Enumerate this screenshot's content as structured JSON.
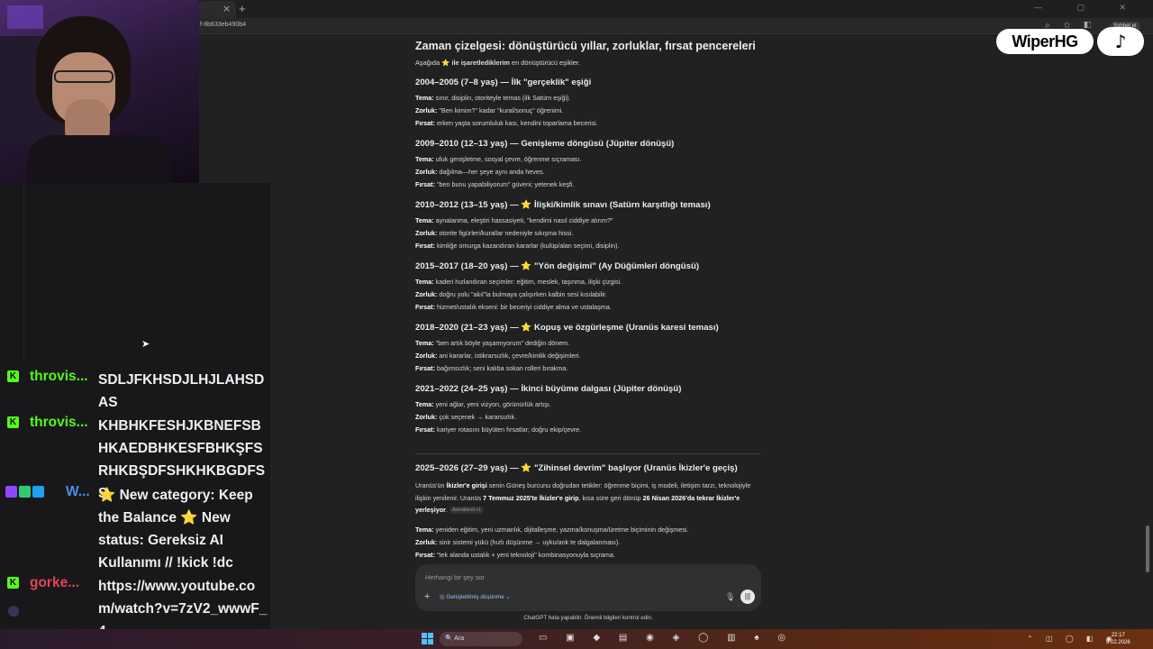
{
  "browser": {
    "tab_close": "×",
    "new_tab": "+",
    "url": "f-8b633eb490b4",
    "profile_label": "Sohbet et"
  },
  "doc": {
    "title": "Zaman çizelgesi: dönüştürücü yıllar, zorluklar, fırsat pencereleri",
    "intro_pre": "Aşağıda ",
    "intro_bold": "ile işaretlediklerim",
    "intro_post": " en dönüştürücü eşikler.",
    "sections": [
      {
        "title_pre": "2004–2005 (7–8 yaş) — İlk \"gerçeklik\" eşiği",
        "starred": false,
        "title_post": "",
        "tema": "sınır, disiplin, otoriteyle temas (ilk Satürn eşiği).",
        "zorluk": "\"Ben kimim?\" kadar \"kural/sonuç\" öğrenimi.",
        "firsat": "erken yaşta sorumluluk kası, kendini toparlama becerisi."
      },
      {
        "title_pre": "2009–2010 (12–13 yaş) — Genişleme döngüsü (Jüpiter dönüşü)",
        "starred": false,
        "title_post": "",
        "tema": "ufuk genişletme, sosyal çevre, öğrenme sıçraması.",
        "zorluk": "dağılma—her şeye aynı anda heves.",
        "firsat": "\"ben bunu yapabiliyorum\" güveni; yetenek keşfi."
      },
      {
        "title_pre": "2010–2012 (13–15 yaş) —",
        "starred": true,
        "title_post": "İlişki/kimlik sınavı (Satürn karşıtlığı teması)",
        "tema": "aynalanma, eleştiri hassasiyeti, \"kendimi nasıl ciddiye alırım?\"",
        "zorluk": "otorite figürleri/kurallar nedeniyle sıkışma hissi.",
        "firsat": "kimliğe omurga kazandıran kararlar (kulüp/alan seçimi, disiplin)."
      },
      {
        "title_pre": "2015–2017 (18–20 yaş) —",
        "starred": true,
        "title_post": "\"Yön değişimi\" (Ay Düğümleri döngüsü)",
        "tema": "kaderi hızlandıran seçimler: eğitim, meslek, taşınma, ilişki çizgisi.",
        "zorluk": "doğru yolu \"akıl\"la bulmaya çalışırken kalbin sesi kısılabilir.",
        "firsat": "hizmet/ustalık ekseni: bir beceriyi ciddiye alma ve ustalaşma."
      },
      {
        "title_pre": "2018–2020 (21–23 yaş) —",
        "starred": true,
        "title_post": "Kopuş ve özgürleşme (Uranüs karesi teması)",
        "tema": "\"ben artık böyle yaşamıyorum\" dediğin dönem.",
        "zorluk": "ani kararlar, istikrarsızlık, çevre/kimlik değişimleri.",
        "firsat": "bağımsızlık; seni kalıba sokan rolleri bırakma."
      },
      {
        "title_pre": "2021–2022 (24–25 yaş) — İkinci büyüme dalgası (Jüpiter dönüşü)",
        "starred": false,
        "title_post": "",
        "tema": "yeni ağlar, yeni vizyon, görünürlük artışı.",
        "zorluk": "çok seçenek → kararsızlık.",
        "firsat": "kariyer rotasını büyüten fırsatlar; doğru ekip/çevre."
      }
    ],
    "labels": {
      "tema": "Tema:",
      "zorluk": "Zorluk:",
      "firsat": "Fırsat:"
    },
    "star": "⭐",
    "last_section": {
      "title_pre": "2025–2026 (27–29 yaş) —",
      "title_post": "\"Zihinsel devrim\" başlıyor (Uranüs İkizler'e geçiş)",
      "para_a": "Uranüs'ün ",
      "para_b": "İkizler'e girişi",
      "para_c": " senin Güneş burcunu doğrudan tetikler: öğrenme biçimi, iş modeli, iletişim tarzı, teknolojiyle ilişkin yenilenir. Uranüs ",
      "para_d": "7 Temmuz 2025'te İkizler'e girip",
      "para_e": ", kısa süre geri dönüp ",
      "para_f": "26 Nisan 2026'da tekrar İkizler'e yerleşiyor",
      "para_g": ".",
      "source_chip": "Astrodienst +1",
      "tema": "yeniden eğitim, yeni uzmanlık, dijitalleşme, yazma/konuşma/üretme biçiminin değişmesi.",
      "zorluk": "sinir sistemi yükü (hızlı düşünme → uyku/ank  te dalgalanması).",
      "firsat": "\"tek alanda ustalık + yeni teknoloji\" kombinasyonuyla sıçrama."
    }
  },
  "composer": {
    "placeholder": "Herhangi bir şey sor",
    "plus": "+",
    "thinking_chip": "◎ Genişletilmiş düşünme ⌄",
    "mic": "🎙",
    "voice": "|||"
  },
  "disclaimer": "ChatGPT hata yapabilir. Önemli bilgileri kontrol edin.",
  "scroll_down": "↓",
  "stream_chat": {
    "messages": [
      {
        "user": "throvis...",
        "badge": "K",
        "text": "SDLJFKHSDJLHJLAHSDAS"
      },
      {
        "user": "throvis...",
        "badge": "K",
        "text": "KHBHKFESHJKBNEFSBHKAEDBHKESFBHKŞFSRHKBŞDFSHKHKBGDFSS"
      },
      {
        "user": "W...",
        "badge": "",
        "text": "⭐ New category: Keep the Balance ⭐ New status: Gereksiz AI Kullanımı // !kick !dc"
      },
      {
        "user": "gorke...",
        "badge": "K",
        "text": "https://www.youtube.com/watch?v=7zV2_wwwF_4"
      }
    ]
  },
  "overlay": {
    "watermark": "WiperHG",
    "tiktok_icon": "♪"
  },
  "taskbar": {
    "search": "🔍 Ara",
    "icons": "▭ ▣ ◆ ▤ ◉ ◈ ◯ ▥ ♠ ◎",
    "tray": "⌃ ◫ ◯ ◧ ◉",
    "time": "22:17",
    "date": "9.02.2026"
  },
  "colors": {
    "accent_kick": "#53fc18",
    "star": "#f5c518",
    "page_bg": "#212121"
  }
}
